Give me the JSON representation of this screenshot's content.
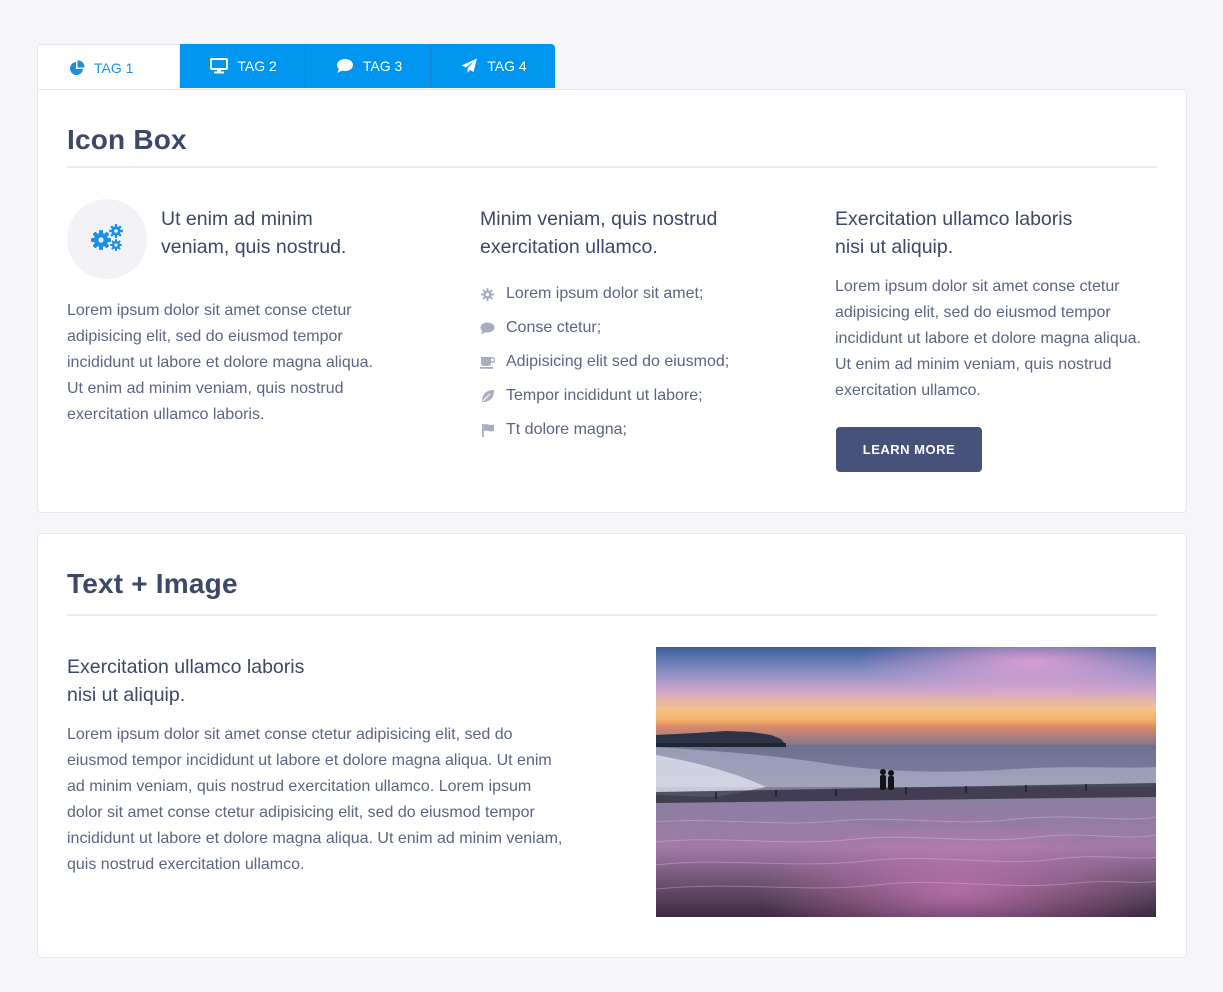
{
  "tabs": [
    {
      "label": "TAG 1",
      "icon": "pie-chart-icon"
    },
    {
      "label": "TAG 2",
      "icon": "monitor-icon"
    },
    {
      "label": "TAG 3",
      "icon": "comment-icon"
    },
    {
      "label": "TAG 4",
      "icon": "paper-plane-icon"
    }
  ],
  "colors": {
    "accent": "#0096f0",
    "button": "#465279",
    "text": "#3d4866"
  },
  "icon_box": {
    "title": "Icon Box",
    "col1": {
      "icon": "gears-icon",
      "heading_line1": "Ut enim ad minim",
      "heading_line2": "veniam, quis nostrud.",
      "text": "Lorem ipsum dolor sit amet conse ctetur adipisicing elit, sed do eiusmod tempor incididunt ut labore et dolore magna aliqua. Ut enim ad minim veniam, quis nostrud exercitation ullamco laboris."
    },
    "col2": {
      "heading_line1": "Minim veniam, quis nostrud",
      "heading_line2": "exercitation ullamco.",
      "items": [
        {
          "icon": "gear-icon",
          "label": "Lorem ipsum dolor sit amet;"
        },
        {
          "icon": "comment-icon",
          "label": "Conse ctetur;"
        },
        {
          "icon": "coffee-cup-icon",
          "label": "Adipisicing elit sed do eiusmod;"
        },
        {
          "icon": "leaf-icon",
          "label": "Tempor incididunt ut labore;"
        },
        {
          "icon": "flag-icon",
          "label": "Tt dolore magna;"
        }
      ]
    },
    "col3": {
      "heading_line1": "Exercitation ullamco laboris",
      "heading_line2": "nisi ut aliquip.",
      "text": "Lorem ipsum dolor sit amet conse ctetur adipisicing elit, sed do eiusmod tempor incididunt ut labore et dolore magna aliqua. Ut enim ad minim veniam, quis nostrud exercitation ullamco.",
      "button_label": "LEARN MORE"
    }
  },
  "text_image": {
    "title": "Text + Image",
    "heading_line1": "Exercitation ullamco laboris",
    "heading_line2": "nisi ut aliquip.",
    "text": "Lorem ipsum dolor sit amet conse ctetur adipisicing elit, sed do eiusmod tempor incididunt ut labore et dolore magna aliqua. Ut enim ad minim veniam, quis nostrud exercitation ullamco. Lorem ipsum dolor sit amet conse ctetur adipisicing elit, sed do eiusmod tempor incididunt ut labore et dolore magna aliqua. Ut enim ad minim veniam, quis nostrud exercitation ullamco.",
    "image": "beach-sunset-photo"
  }
}
